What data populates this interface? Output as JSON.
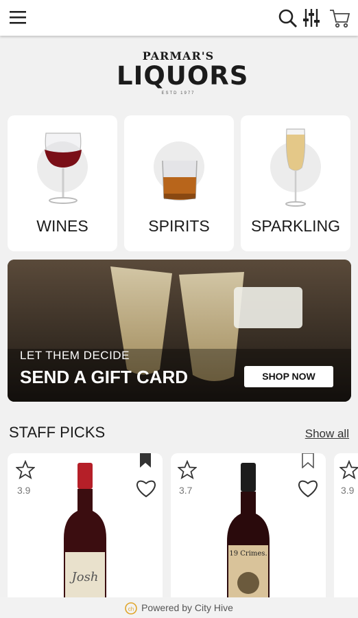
{
  "header": {
    "menu_icon": "hamburger-icon",
    "search_icon": "search-icon",
    "filter_icon": "filter-icon",
    "cart_icon": "cart-icon"
  },
  "logo": {
    "line1": "PARMAR'S",
    "line2": "LIQUORS",
    "line3": "ESTD 1977"
  },
  "categories": [
    {
      "label": "WINES",
      "icon": "wine-glass-icon"
    },
    {
      "label": "SPIRITS",
      "icon": "whiskey-glass-icon"
    },
    {
      "label": "SPARKLING",
      "icon": "champagne-flute-icon"
    }
  ],
  "banner": {
    "kicker": "LET THEM DECIDE",
    "headline": "SEND A GIFT CARD",
    "button": "SHOP NOW"
  },
  "staff_picks": {
    "title": "STAFF PICKS",
    "show_all": "Show all",
    "products": [
      {
        "rating": "3.9",
        "bookmarked": true,
        "label_text": "Josh"
      },
      {
        "rating": "3.7",
        "bookmarked": false,
        "label_text": "19 Crimes."
      },
      {
        "rating": "3.9"
      }
    ]
  },
  "footer": {
    "text": "Powered by City Hive"
  },
  "colors": {
    "wine_red": "#7a0f17",
    "bottle_red": "#b51f28",
    "button_bg": "#ffffff"
  }
}
